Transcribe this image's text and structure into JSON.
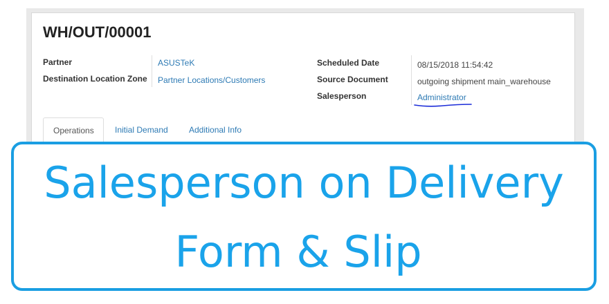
{
  "record": {
    "title": "WH/OUT/00001",
    "fields_left": [
      {
        "label": "Partner",
        "value": "ASUSTeK",
        "is_link": true
      },
      {
        "label": "Destination Location Zone",
        "value": "Partner Locations/Customers",
        "is_link": true
      }
    ],
    "fields_right": [
      {
        "label": "Scheduled Date",
        "value": "08/15/2018 11:54:42",
        "is_link": false
      },
      {
        "label": "Source Document",
        "value": "outgoing shipment main_warehouse",
        "is_link": false
      },
      {
        "label": "Salesperson",
        "value": "Administrator",
        "is_link": true
      }
    ],
    "tabs": [
      {
        "label": "Operations",
        "active": true
      },
      {
        "label": "Initial Demand",
        "active": false
      },
      {
        "label": "Additional Info",
        "active": false
      }
    ]
  },
  "overlay": {
    "line1": "Salesperson on Delivery",
    "line2": "Form & Slip"
  },
  "colors": {
    "link": "#2d7ab4",
    "overlay_border": "#1a9ee2",
    "overlay_text": "#1aa3ea",
    "annotation_underline": "#1a2bd8"
  }
}
